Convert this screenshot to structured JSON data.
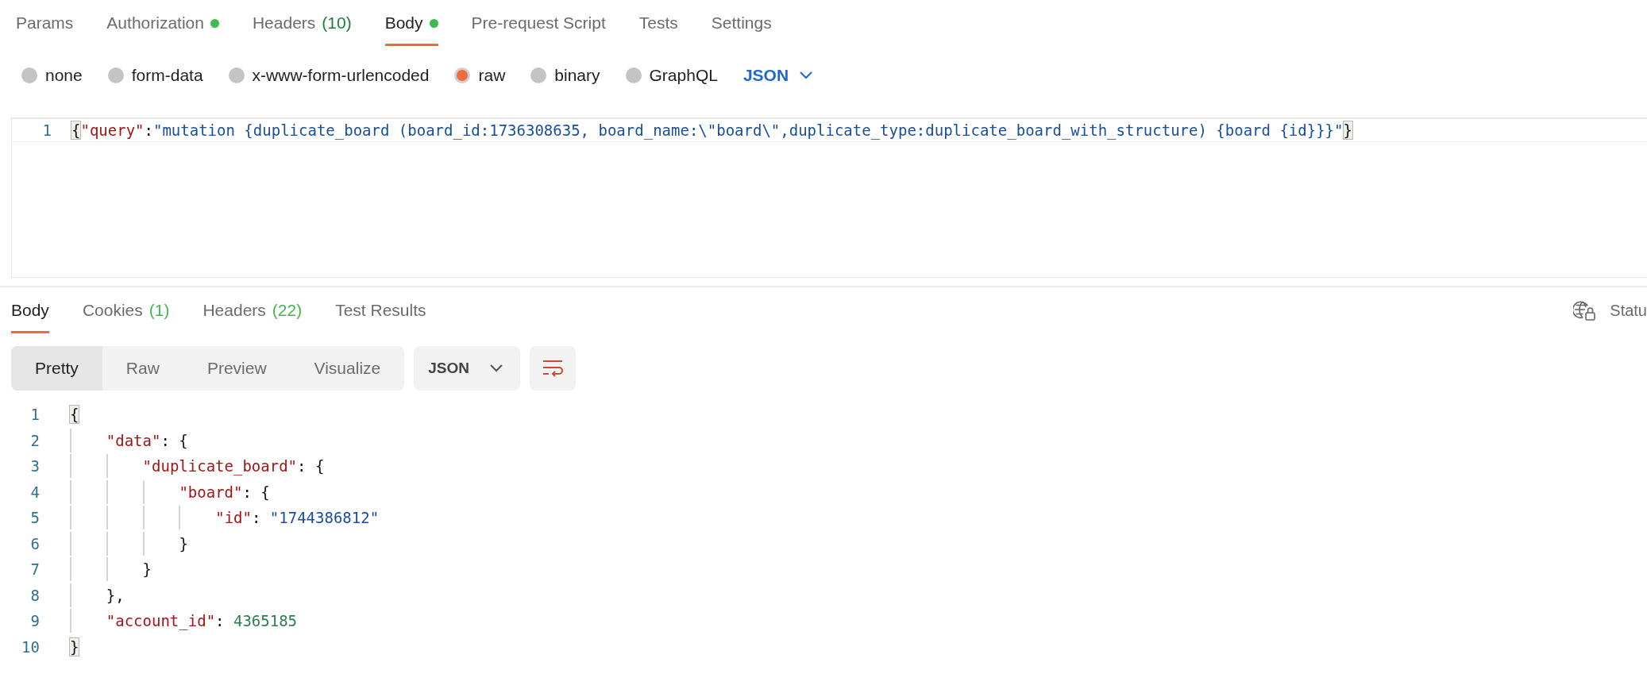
{
  "request_tabs": [
    {
      "label": "Params",
      "dot": false,
      "selected": false
    },
    {
      "label": "Authorization",
      "dot": true,
      "selected": false
    },
    {
      "label": "Headers",
      "count": "(10)",
      "dot": false,
      "selected": false
    },
    {
      "label": "Body",
      "dot": true,
      "selected": true
    },
    {
      "label": "Pre-request Script",
      "dot": false,
      "selected": false
    },
    {
      "label": "Tests",
      "dot": false,
      "selected": false
    },
    {
      "label": "Settings",
      "dot": false,
      "selected": false
    }
  ],
  "body_types": [
    {
      "label": "none",
      "selected": false
    },
    {
      "label": "form-data",
      "selected": false
    },
    {
      "label": "x-www-form-urlencoded",
      "selected": false
    },
    {
      "label": "raw",
      "selected": true
    },
    {
      "label": "binary",
      "selected": false
    },
    {
      "label": "GraphQL",
      "selected": false
    }
  ],
  "raw_format": "JSON",
  "request_editor": {
    "lines": [
      {
        "number": "1",
        "tokens": [
          {
            "kind": "bracket",
            "text": "{"
          },
          {
            "kind": "key",
            "text": "\"query\""
          },
          {
            "kind": "punct",
            "text": ":"
          },
          {
            "kind": "string",
            "text": "\"mutation {duplicate_board (board_id:1736308635, board_name:\\\"board\\\",duplicate_type:duplicate_board_with_structure) {board {id}}}\""
          },
          {
            "kind": "bracket",
            "text": "}"
          }
        ]
      }
    ]
  },
  "response_tabs": [
    {
      "label": "Body",
      "selected": true
    },
    {
      "label": "Cookies",
      "count": "(1)",
      "selected": false
    },
    {
      "label": "Headers",
      "count": "(22)",
      "selected": false
    },
    {
      "label": "Test Results",
      "selected": false
    }
  ],
  "status_label": "Statu",
  "view_modes": [
    {
      "label": "Pretty",
      "selected": true
    },
    {
      "label": "Raw",
      "selected": false
    },
    {
      "label": "Preview",
      "selected": false
    },
    {
      "label": "Visualize",
      "selected": false
    }
  ],
  "response_format": "JSON",
  "response_body": {
    "lines": [
      {
        "number": "1",
        "tokens": [
          {
            "kind": "bracket",
            "text": "{"
          }
        ],
        "children": [
          {
            "number": "2",
            "tokens": [
              {
                "kind": "key",
                "text": "\"data\""
              },
              {
                "kind": "punct",
                "text": ": {"
              }
            ],
            "children": [
              {
                "number": "3",
                "tokens": [
                  {
                    "kind": "key",
                    "text": "\"duplicate_board\""
                  },
                  {
                    "kind": "punct",
                    "text": ": {"
                  }
                ],
                "children": [
                  {
                    "number": "4",
                    "tokens": [
                      {
                        "kind": "key",
                        "text": "\"board\""
                      },
                      {
                        "kind": "punct",
                        "text": ": {"
                      }
                    ],
                    "children": [
                      {
                        "number": "5",
                        "tokens": [
                          {
                            "kind": "key",
                            "text": "\"id\""
                          },
                          {
                            "kind": "punct",
                            "text": ": "
                          },
                          {
                            "kind": "string",
                            "text": "\"1744386812\""
                          }
                        ]
                      }
                    ]
                  },
                  {
                    "number": "6",
                    "tokens": [
                      {
                        "kind": "punct",
                        "text": "}"
                      }
                    ]
                  }
                ]
              },
              {
                "number": "7",
                "tokens": [
                  {
                    "kind": "punct",
                    "text": "}"
                  }
                ]
              }
            ]
          },
          {
            "number": "8",
            "tokens": [
              {
                "kind": "punct",
                "text": "},"
              }
            ]
          },
          {
            "number": "9",
            "tokens": [
              {
                "kind": "key",
                "text": "\"account_id\""
              },
              {
                "kind": "punct",
                "text": ": "
              },
              {
                "kind": "number",
                "text": "4365185"
              }
            ]
          }
        ]
      },
      {
        "number": "10",
        "tokens": [
          {
            "kind": "bracket",
            "text": "}"
          }
        ]
      }
    ]
  }
}
